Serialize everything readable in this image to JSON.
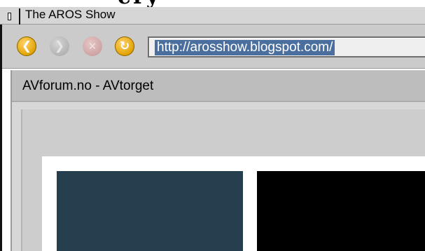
{
  "top_strip": {
    "heading": "ery"
  },
  "window": {
    "title": "The AROS Show",
    "depth_gadget_icon": "depth-gadget-icon"
  },
  "toolbar": {
    "back_icon": "arrow-left-icon",
    "forward_icon": "arrow-right-icon",
    "stop_icon": "close-icon",
    "reload_icon": "reload-icon",
    "url": "http://arosshow.blogspot.com/"
  },
  "tab": {
    "title": "AVforum.no - AVtorget"
  },
  "colors": {
    "toolbar_bg": "#cbcbcb",
    "url_selection": "#4a6f9e",
    "nav_active": "#e0a100",
    "image_blue": "#253f4f",
    "image_black": "#000000"
  }
}
